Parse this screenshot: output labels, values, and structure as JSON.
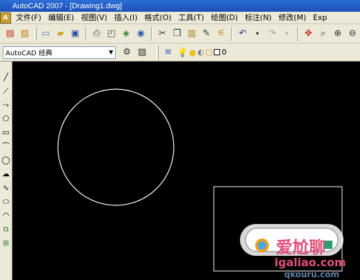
{
  "window": {
    "title": "AutoCAD 2007 - [Drawing1.dwg]"
  },
  "menu": {
    "items": [
      {
        "label": "文件(F)"
      },
      {
        "label": "编辑(E)"
      },
      {
        "label": "视图(V)"
      },
      {
        "label": "插入(I)"
      },
      {
        "label": "格式(O)"
      },
      {
        "label": "工具(T)"
      },
      {
        "label": "绘图(D)"
      },
      {
        "label": "标注(N)"
      },
      {
        "label": "修改(M)"
      },
      {
        "label": "Exp"
      }
    ]
  },
  "workspace": {
    "value": "AutoCAD 经典"
  },
  "layer": {
    "value": "0"
  },
  "watermark": {
    "brand": "爱尬聊",
    "url": "igaliao.com",
    "url2": "qkouru.com"
  },
  "colors": {
    "titlebar": "#1c4fb5",
    "chrome": "#ece9d8",
    "canvas": "#000000",
    "entity": "#ffffff"
  }
}
